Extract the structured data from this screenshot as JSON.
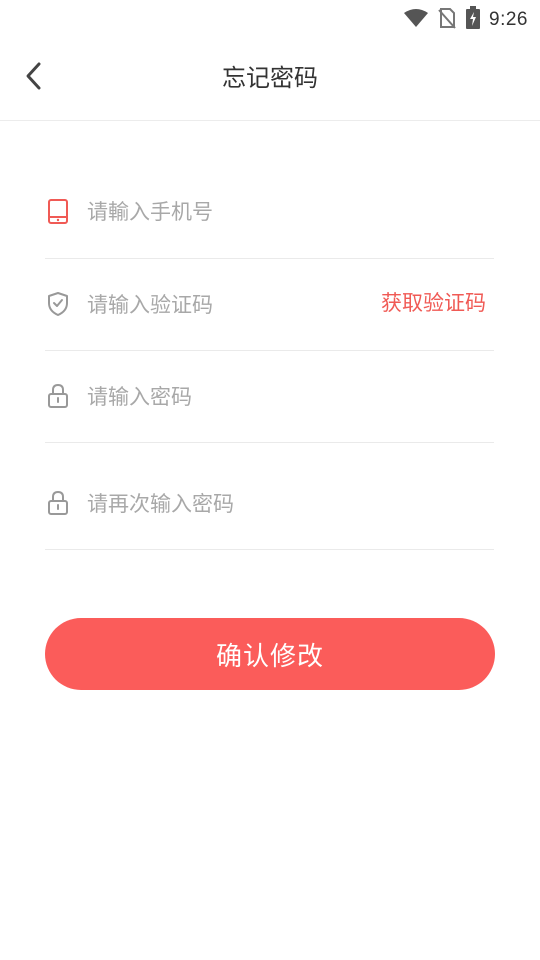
{
  "status_bar": {
    "time": "9:26",
    "icons": [
      "wifi-icon",
      "no-sim-icon",
      "battery-charging-icon"
    ]
  },
  "header": {
    "title": "忘记密码",
    "back_icon": "chevron-left-icon"
  },
  "form": {
    "phone": {
      "placeholder": "请輸入手机号",
      "icon": "phone-icon",
      "value": ""
    },
    "code": {
      "placeholder": "请输入验证码",
      "icon": "shield-check-icon",
      "value": "",
      "action_label": "获取验证码"
    },
    "password": {
      "placeholder": "请输入密码",
      "icon": "lock-icon",
      "value": ""
    },
    "confirm_password": {
      "placeholder": "请再次输入密码",
      "icon": "lock-icon",
      "value": ""
    }
  },
  "submit": {
    "label": "确认修改"
  },
  "colors": {
    "accent": "#fb5c5a",
    "accent_text": "#f05a55",
    "placeholder": "#a8a8a8",
    "divider": "#eaeaea"
  }
}
